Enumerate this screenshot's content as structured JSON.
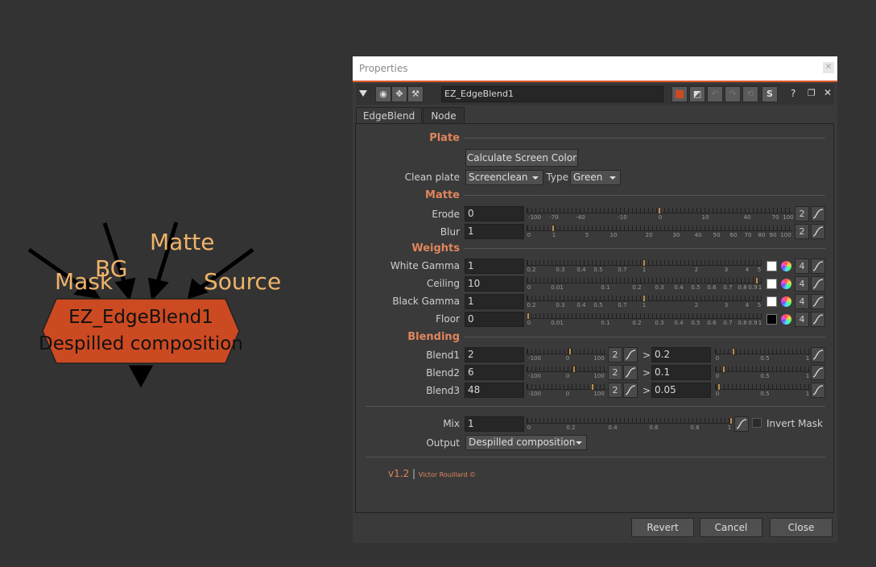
{
  "node": {
    "title": "EZ_EdgeBlend1",
    "subtitle": "Despilled composition",
    "inputs": [
      "Mask",
      "BG",
      "Matte",
      "Source"
    ],
    "color": "#cc4a22"
  },
  "window": {
    "title": "Properties",
    "node_name": "EZ_EdgeBlend1",
    "tabs": [
      "EdgeBlend",
      "Node"
    ],
    "active_tab": "EdgeBlend"
  },
  "plate": {
    "section": "Plate",
    "calc_button": "Calculate Screen Color",
    "clean_plate_label": "Clean plate",
    "clean_plate_value": "Screenclean",
    "type_label": "Type",
    "type_value": "Green"
  },
  "matte": {
    "section": "Matte",
    "erode_label": "Erode",
    "erode_value": "0",
    "erode_ticks": [
      "-100",
      "-70",
      "-40",
      "-10",
      "0",
      "10",
      "40",
      "70",
      "100"
    ],
    "erode_channels": "2",
    "blur_label": "Blur",
    "blur_value": "1",
    "blur_ticks": [
      "0",
      "1",
      "5",
      "10",
      "20",
      "30",
      "40",
      "50",
      "60",
      "70",
      "80",
      "90",
      "100"
    ],
    "blur_channels": "2"
  },
  "weights": {
    "section": "Weights",
    "white_gamma_label": "White Gamma",
    "white_gamma_value": "1",
    "ceiling_label": "Ceiling",
    "ceiling_value": "10",
    "black_gamma_label": "Black Gamma",
    "black_gamma_value": "1",
    "floor_label": "Floor",
    "floor_value": "0",
    "gamma_ticks": [
      "0.2",
      "0.3",
      "0.4",
      "0.5",
      "0.7",
      "1",
      "2",
      "3",
      "4",
      "5"
    ],
    "ceiling_ticks": [
      "0",
      "0.01",
      "0.1",
      "0.2",
      "0.3",
      "0.4",
      "0.5",
      "0.6",
      "0.7",
      "0.8",
      "0.9",
      "1"
    ],
    "channels": "4",
    "white_swatch": "#ffffff",
    "black_swatch": "#000000"
  },
  "blending": {
    "section": "Blending",
    "rows": [
      {
        "label": "Blend1",
        "value": "2",
        "channels": "2",
        "gt": ">",
        "value2": "0.2"
      },
      {
        "label": "Blend2",
        "value": "6",
        "channels": "2",
        "gt": ">",
        "value2": "0.1"
      },
      {
        "label": "Blend3",
        "value": "48",
        "channels": "2",
        "gt": ">",
        "value2": "0.05"
      }
    ],
    "blend_ticks": [
      "-100",
      "0",
      "100"
    ],
    "right_ticks": [
      "0",
      "0.5",
      "1"
    ]
  },
  "output": {
    "mix_label": "Mix",
    "mix_value": "1",
    "mix_ticks": [
      "0",
      "0.2",
      "0.4",
      "0.6",
      "0.8",
      "1"
    ],
    "invert_mask_label": "Invert Mask",
    "output_label": "Output",
    "output_value": "Despilled composition"
  },
  "footer": {
    "version": "v1.2",
    "sep": "|",
    "author": "Victor Rouillard ©"
  },
  "buttons": {
    "revert": "Revert",
    "cancel": "Cancel",
    "close": "Close"
  },
  "colors": {
    "accent": "#e0855c",
    "input_label": "#f0b36a",
    "title_line": "#e05a2a"
  }
}
